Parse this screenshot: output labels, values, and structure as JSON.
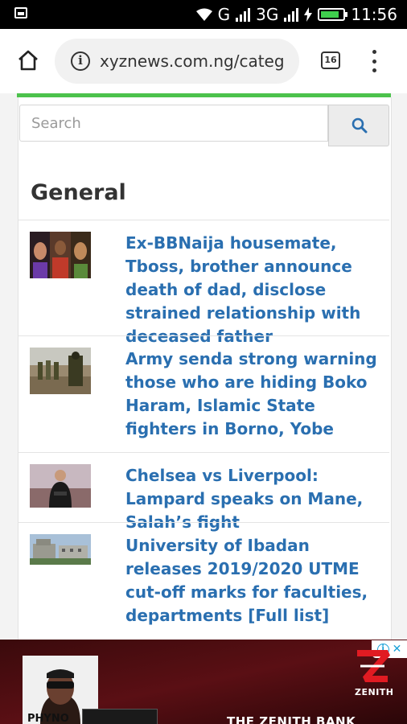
{
  "status_bar": {
    "network": "G",
    "network2": "3G",
    "time": "11:56",
    "battery_level": 0.85
  },
  "browser": {
    "url": "xyznews.com.ng/categ",
    "tab_count": "16"
  },
  "search": {
    "placeholder": "Search",
    "value": ""
  },
  "section": {
    "title": "General"
  },
  "articles": [
    {
      "title": "Ex-BBNaija housemate, Tboss, brother announce death of dad, disclose strained relationship with deceased father",
      "thumb": "three-portraits"
    },
    {
      "title": "Army senda strong warning those who are hiding Boko Haram, Islamic State fighters in Borno, Yobe",
      "thumb": "soldiers"
    },
    {
      "title": "Chelsea vs Liverpool: Lampard speaks on Mane, Salah’s fight",
      "thumb": "coach-in-stadium"
    },
    {
      "title": "University of Ibadan releases 2019/2020 UTME cut-off marks for faculties, departments [Full list]",
      "thumb": "university-building"
    }
  ],
  "ad": {
    "headline": "THE ZENITH BANK",
    "brand": "ZENITH",
    "person_caption": "PHYNO"
  },
  "colors": {
    "accent_green": "#4cc24c",
    "link_blue": "#2a6fb0",
    "search_icon": "#2a6fb0",
    "zenith_red": "#e11b22"
  }
}
